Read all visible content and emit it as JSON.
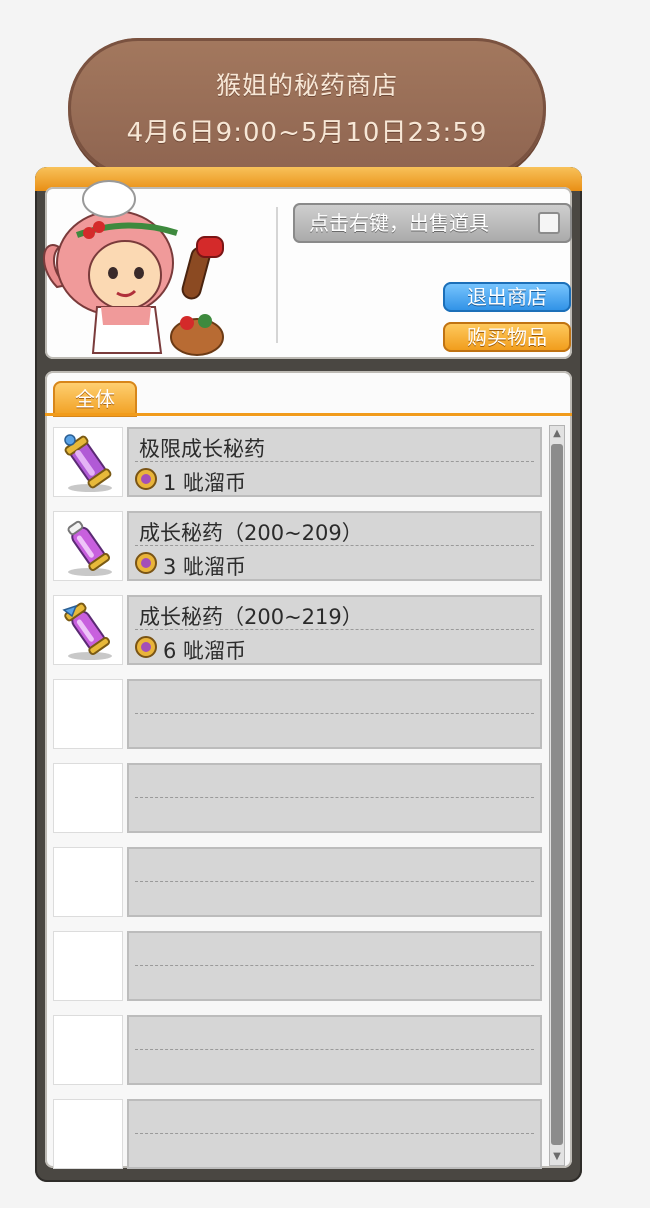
{
  "banner": {
    "title": "猴姐的秘药商店",
    "time_range": "4月6日9:00~5月10日23:59"
  },
  "shop": {
    "sell_toggle_label": "点击右键，出售道具",
    "sell_toggle_checked": false,
    "exit_button_label": "退出商店",
    "buy_button_label": "购买物品",
    "tabs": [
      {
        "label": "全体",
        "active": true
      }
    ],
    "items": [
      {
        "name": "极限成长秘药",
        "price": "1 呲溜币",
        "icon": "limit-growth-potion-icon"
      },
      {
        "name": "成长秘药（200~209）",
        "price": "3 呲溜币",
        "icon": "growth-potion-pink-icon"
      },
      {
        "name": "成长秘药（200~219）",
        "price": "6 呲溜币",
        "icon": "growth-potion-winged-icon"
      },
      {
        "name": "",
        "price": ""
      },
      {
        "name": "",
        "price": ""
      },
      {
        "name": "",
        "price": ""
      },
      {
        "name": "",
        "price": ""
      },
      {
        "name": "",
        "price": ""
      },
      {
        "name": "",
        "price": ""
      }
    ],
    "scroll_up_glyph": "▲",
    "scroll_down_glyph": "▼"
  },
  "colors": {
    "banner": "#9a6e57",
    "tab_active": "#f09d1e",
    "exit_button": "#2c8fe5",
    "buy_button": "#f09a18"
  }
}
